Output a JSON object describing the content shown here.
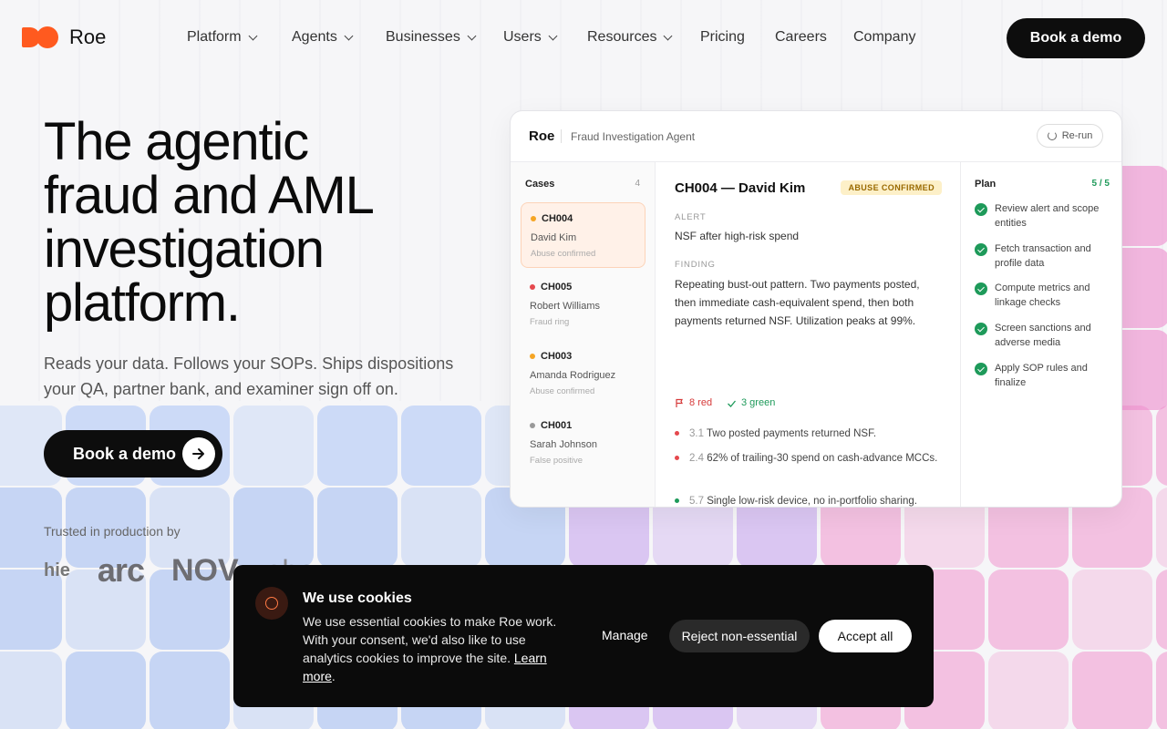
{
  "header": {
    "brand": "Roe",
    "nav": [
      {
        "label": "Platform",
        "dropdown": true
      },
      {
        "label": "Agents",
        "dropdown": true
      },
      {
        "label": "Businesses",
        "dropdown": true
      },
      {
        "label": "Users",
        "dropdown": true
      },
      {
        "label": "Resources",
        "dropdown": true
      },
      {
        "label": "Pricing",
        "dropdown": false
      },
      {
        "label": "Careers",
        "dropdown": false
      },
      {
        "label": "Company",
        "dropdown": false
      }
    ],
    "cta": "Book a demo"
  },
  "hero": {
    "title_lines": [
      "The agentic",
      "fraud and AML",
      "investigation",
      "platform."
    ],
    "subtitle_lines": [
      "Reads your data. Follows your SOPs. Ships dispositions",
      "your QA, partner bank, and examiner sign off on."
    ],
    "cta": "Book a demo",
    "trusted": "Trusted in production by",
    "logos": [
      "hie",
      "arc",
      "NOV",
      "ebay"
    ]
  },
  "card": {
    "brand": "Roe",
    "agent": "Fraud Investigation Agent",
    "rerun": "Re-run",
    "cases_label": "Cases",
    "cases_count": "4",
    "cases": [
      {
        "id": "CH004",
        "name": "David Kim",
        "status": "Abuse confirmed",
        "color": "#f5a524"
      },
      {
        "id": "CH005",
        "name": "Robert Williams",
        "status": "Fraud ring",
        "color": "#e5484d"
      },
      {
        "id": "CH003",
        "name": "Amanda Rodriguez",
        "status": "Abuse confirmed",
        "color": "#f5a524"
      },
      {
        "id": "CH001",
        "name": "Sarah Johnson",
        "status": "False positive",
        "color": "#999999"
      }
    ],
    "detail": {
      "title": "CH004 — David Kim",
      "badge": "ABUSE CONFIRMED",
      "alert_label": "ALERT",
      "alert": "NSF after high-risk spend",
      "finding_label": "FINDING",
      "finding_lines": [
        "Repeating bust-out pattern. Two payments posted,",
        "then immediate cash-equivalent spend, then both",
        "payments returned NSF. Utilization peaks at 99%."
      ],
      "red": "8 red",
      "green": "3 green",
      "bullets": [
        {
          "num": "3.1",
          "text": "Two posted payments returned NSF.",
          "color": "#e5484d"
        },
        {
          "num": "2.4",
          "text": "62% of trailing-30 spend on cash-advance MCCs.",
          "color": "#e5484d"
        },
        {
          "num": "5.7",
          "text": "Single low-risk device, no in-portfolio sharing.",
          "color": "#1e9a5a"
        }
      ]
    },
    "plan_label": "Plan",
    "plan_count": "5 / 5",
    "plan": [
      "Review alert and scope entities",
      "Fetch transaction and profile data",
      "Compute metrics and linkage checks",
      "Screen sanctions and adverse media",
      "Apply SOP rules and finalize"
    ]
  },
  "cookie": {
    "title": "We use cookies",
    "body": "We use essential cookies to make Roe work. With your consent, we'd also like to use analytics cookies to improve the site.",
    "link": "Learn more",
    "manage": "Manage",
    "reject": "Reject non-essential",
    "accept": "Accept all"
  }
}
